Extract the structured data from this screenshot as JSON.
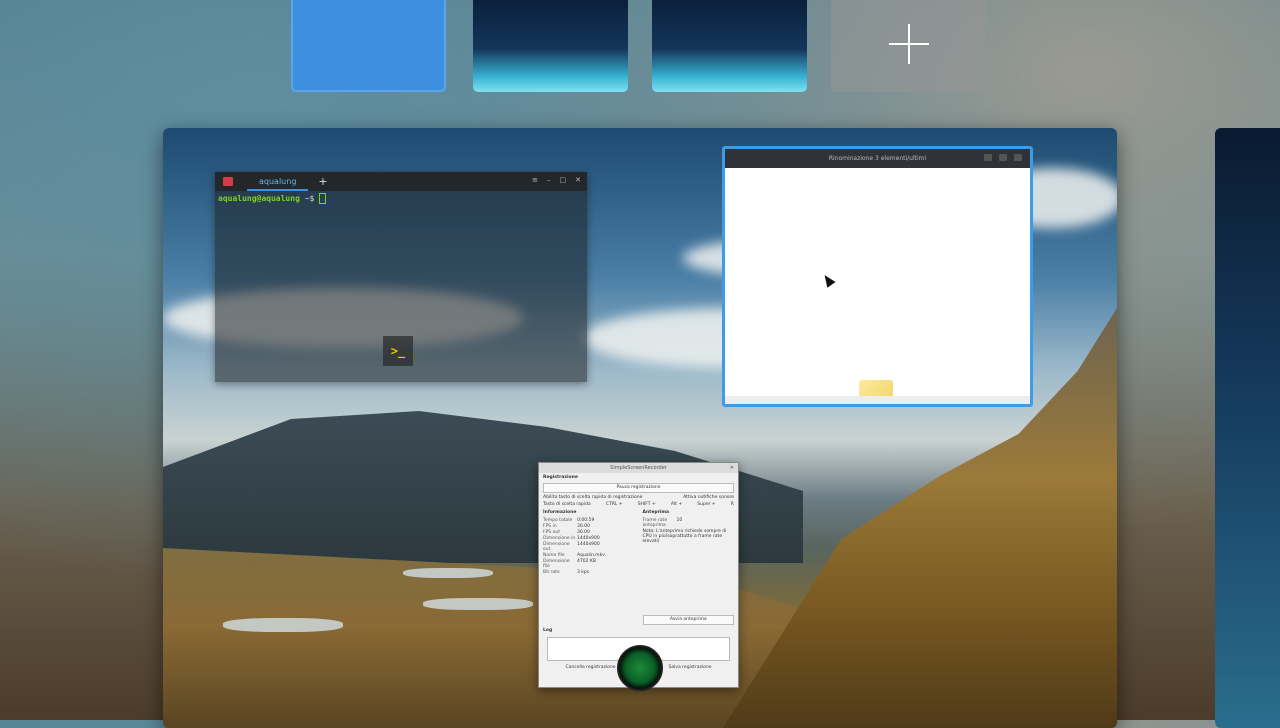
{
  "workspaces": {
    "add_label": "+"
  },
  "terminal": {
    "tab_label": "aqualung",
    "new_tab": "+",
    "prompt_user": "aqualung@aqualung",
    "prompt_path": " ~$ ",
    "logo_text": ">_"
  },
  "file_manager": {
    "title": "Rinominazione 3 elementi/ultimi"
  },
  "recorder": {
    "title": "SimpleScreenRecorder",
    "section_recording": "Registrazione",
    "pause_button": "Pausa registrazione",
    "enable_hotkey": "Abilita tasto di scelta rapida di registrazione",
    "audio_notify": "Attiva notifiche sonore",
    "hotkey_label": "Tasto di scelta rapida",
    "hotkey_ctrl": "CTRL +",
    "hotkey_shift": "SHIFT +",
    "hotkey_alt": "Alt +",
    "hotkey_super": "Super +",
    "hotkey_key": "R",
    "section_info": "Informazione",
    "section_preview": "Anteprima",
    "info": [
      {
        "k": "Tempo totale",
        "v": "0:00:59"
      },
      {
        "k": "FPS in",
        "v": "30.00"
      },
      {
        "k": "FPS out",
        "v": "30.00"
      },
      {
        "k": "Dimensione in",
        "v": "1440x900"
      },
      {
        "k": "Dimensione out",
        "v": "1440x900"
      },
      {
        "k": "Nome file",
        "v": "Aqualin.mkv"
      },
      {
        "k": "Dimensione file",
        "v": "4702 KB"
      },
      {
        "k": "Bit rate",
        "v": "3 kps"
      }
    ],
    "preview_frames_label": "Frame rate anteprima",
    "preview_frames_value": "10",
    "preview_note": "Nota: L'anteprima richiede sempre di CPU in più(soprattutto a frame rate elevati)",
    "start_preview": "Avvia anteprima",
    "log_label": "Log",
    "cancel_button": "Cancella registrazione",
    "save_button": "Salva registrazione"
  }
}
